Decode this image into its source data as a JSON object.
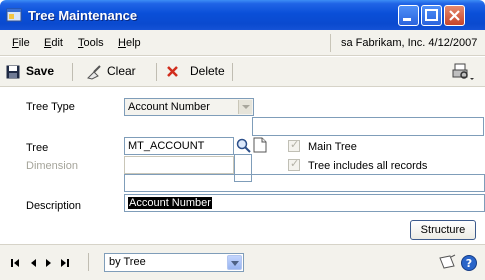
{
  "window": {
    "title": "Tree Maintenance"
  },
  "menu": {
    "items": [
      {
        "label": "File",
        "underline": "F"
      },
      {
        "label": "Edit",
        "underline": "E"
      },
      {
        "label": "Tools",
        "underline": "T"
      },
      {
        "label": "Help",
        "underline": "H"
      }
    ],
    "status": "sa  Fabrikam, Inc.  4/12/2007"
  },
  "toolbar": {
    "save_label": "Save",
    "clear_label": "Clear",
    "delete_label": "Delete"
  },
  "form": {
    "tree_type_label": "Tree Type",
    "tree_type_value": "Account Number",
    "tree_label": "Tree",
    "tree_value": "MT_ACCOUNT",
    "dimension_label": "Dimension",
    "dimension_value": "",
    "main_tree_label": "Main Tree",
    "all_records_label": "Tree includes all records",
    "description_label": "Description",
    "description_value": "Account Number",
    "structure_button": "Structure"
  },
  "bottom": {
    "sort_value": "by Tree"
  },
  "colors": {
    "titlebar": "#0a4fd8",
    "chrome": "#f3f2ec",
    "field_border": "#7f9db9"
  }
}
